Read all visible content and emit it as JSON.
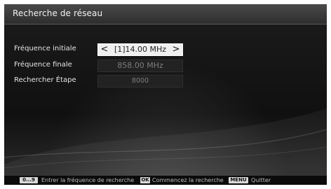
{
  "header": {
    "title": "Recherche de réseau"
  },
  "form": {
    "rows": [
      {
        "label": "Fréquence initiale",
        "value": "[1]14.00 MHz"
      },
      {
        "label": "Fréquence finale",
        "value": "858.00 MHz"
      },
      {
        "label": "Rechercher Étape",
        "value": "8000"
      }
    ],
    "arrow_left": "<",
    "arrow_right": ">"
  },
  "footer": {
    "keys": [
      {
        "key": "0...9",
        "text": "Entrer la fréquence de recherche"
      },
      {
        "key": "OK",
        "text": "Commencez la recherche"
      },
      {
        "key": "MENU",
        "text": "Quitter"
      }
    ]
  }
}
